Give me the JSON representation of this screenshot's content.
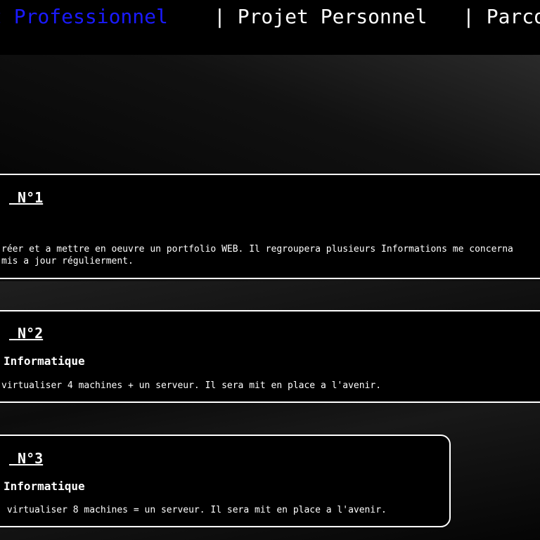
{
  "nav": {
    "items": [
      {
        "label": "t Professionnel",
        "active": true
      },
      {
        "label": "| Projet Personnel",
        "active": false
      },
      {
        "label": "| Parco",
        "active": false
      }
    ]
  },
  "projects": [
    {
      "title": " N°1",
      "subtitle": "",
      "description": "réer et a mettre en oeuvre un portfolio WEB. Il regroupera plusieurs Informations me concerna\nmis a jour régulierment."
    },
    {
      "title": " N°2",
      "subtitle": "Informatique",
      "description": "virtualiser 4 machines + un serveur. Il sera mit en place a l'avenir."
    },
    {
      "title": " N°3",
      "subtitle": "Informatique",
      "description": " virtualiser 8 machines = un serveur. Il sera mit en place a l'avenir."
    }
  ]
}
